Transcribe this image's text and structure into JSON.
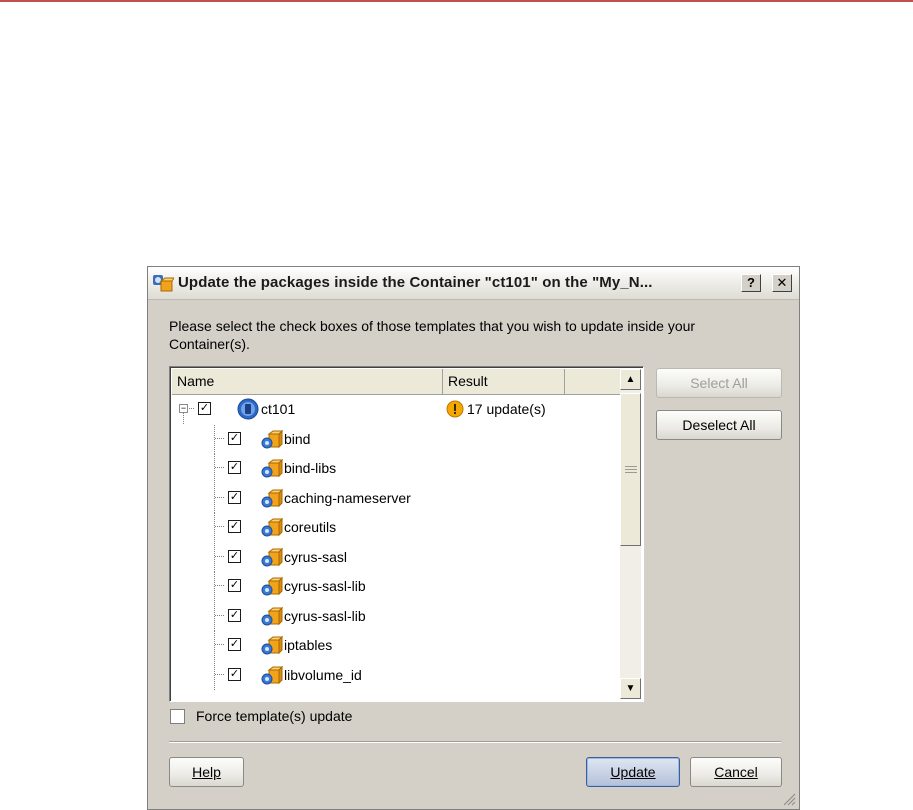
{
  "dialog": {
    "title": "Update the packages inside the Container \"ct101\" on the \"My_N...",
    "help_glyph": "?",
    "close_glyph": "✕",
    "instructions": "Please select the check boxes of those templates that you wish to update inside your Container(s).",
    "columns": {
      "name": "Name",
      "result": "Result"
    },
    "root": {
      "label": "ct101",
      "checked": true,
      "expanded": true,
      "result_icon": "warning-icon",
      "result": "17 update(s)"
    },
    "packages": [
      {
        "label": "bind",
        "checked": true
      },
      {
        "label": "bind-libs",
        "checked": true
      },
      {
        "label": "caching-nameserver",
        "checked": true
      },
      {
        "label": "coreutils",
        "checked": true
      },
      {
        "label": "cyrus-sasl",
        "checked": true
      },
      {
        "label": "cyrus-sasl-lib",
        "checked": true
      },
      {
        "label": "cyrus-sasl-lib",
        "checked": true
      },
      {
        "label": "iptables",
        "checked": true
      },
      {
        "label": "libvolume_id",
        "checked": true
      }
    ],
    "side_buttons": {
      "select_all": "Select All",
      "deselect_all": "Deselect All"
    },
    "force_update": {
      "label": "Force template(s) update",
      "checked": false
    },
    "footer_buttons": {
      "help": "Help",
      "update": "Update",
      "cancel": "Cancel"
    },
    "colors": {
      "accent_rule": "#c0504d",
      "dialog_bg": "#d4d0c8",
      "warning": "#f5a800",
      "package_icon": "#f2a31c"
    }
  }
}
